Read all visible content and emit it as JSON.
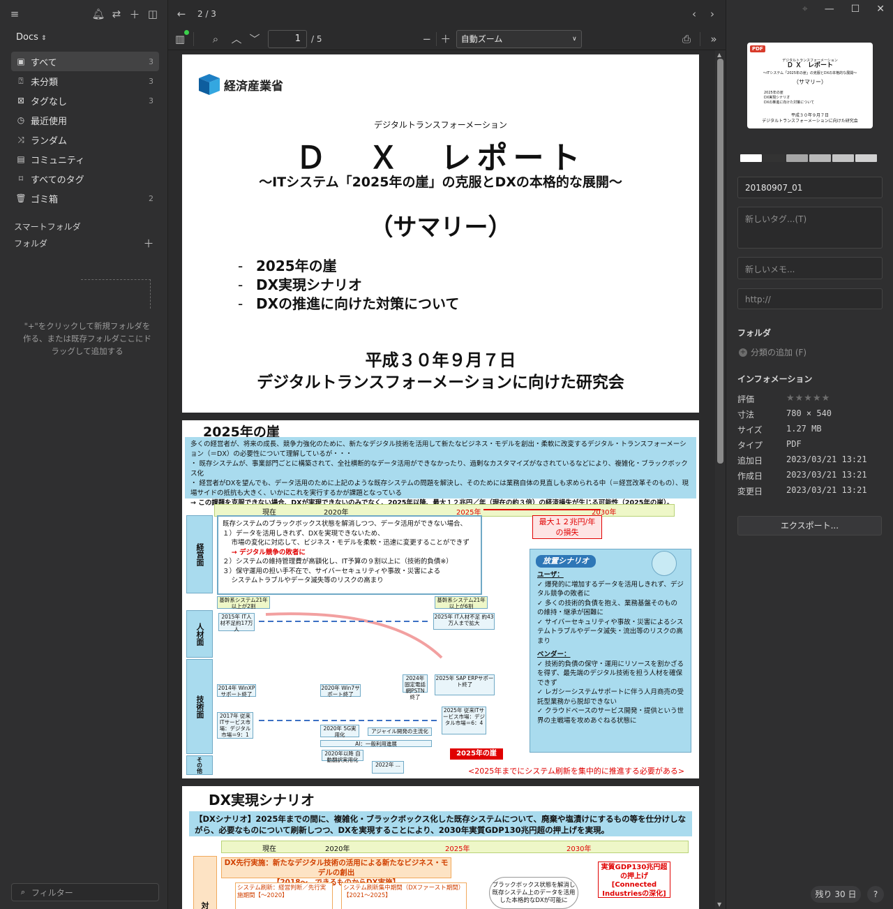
{
  "sidebar": {
    "library": "Docs",
    "items": [
      {
        "label": "すべて",
        "count": "3",
        "icon": "all-docs-icon"
      },
      {
        "label": "未分類",
        "count": "3",
        "icon": "unsorted-icon"
      },
      {
        "label": "タグなし",
        "count": "3",
        "icon": "untagged-icon"
      },
      {
        "label": "最近使用",
        "count": "",
        "icon": "recent-icon"
      },
      {
        "label": "ランダム",
        "count": "",
        "icon": "random-icon"
      },
      {
        "label": "コミュニティ",
        "count": "",
        "icon": "community-icon"
      },
      {
        "label": "すべてのタグ",
        "count": "",
        "icon": "tag-icon"
      },
      {
        "label": "ゴミ箱",
        "count": "2",
        "icon": "trash-icon"
      }
    ],
    "smart_folders": "スマートフォルダ",
    "folders": "フォルダ",
    "folder_hint": "\"+\"をクリックして新規フォルダを作る、または既存フォルダここにドラッグして追加する",
    "filter_placeholder": "フィルター"
  },
  "viewer": {
    "page_counter": "2 / 3",
    "pdf_page": "1",
    "pdf_total": "/ 5",
    "zoom": "自動ズーム"
  },
  "page1": {
    "org": "経済産業省",
    "kicker": "デジタルトランスフォーメーション",
    "title": "Ｄ　Ｘ　レポート",
    "subtitle": "～ITシステム「2025年の崖」の克服とDXの本格的な展開～",
    "summary": "（サマリー）",
    "bullets": [
      "2025年の崖",
      "DX実現シナリオ",
      "DXの推進に向けた対策について"
    ],
    "date": "平成３０年９月７日",
    "group": "デジタルトランスフォーメーションに向けた研究会"
  },
  "page2": {
    "title": "2025年の崖",
    "intro1": "多くの経営者が、将来の成長、競争力強化のために、新たなデジタル技術を活用して新たなビジネス・モデルを創出・柔軟に改変するデジタル・トランスフォーメーション（＝DX）の必要性について理解しているが・・・",
    "intro2": "・ 既存システムが、事業部門ごとに構築されて、全社横断的なデータ活用ができなかったり、過剰なカスタマイズがなされているなどにより、複雑化・ブラックボックス化",
    "intro3": "・ 経営者がDXを望んでも、データ活用のために上記のような既存システムの問題を解決し、そのためには業務自体の見直しも求められる中（＝経営改革そのもの）、現場サイドの抵抗も大きく、いかにこれを実行するかが課題となっている",
    "intro4": "→ この課題を克服できない場合、DXが実現できないのみでなく、2025年以降、最大１２兆円／年（現在の約３倍）の経済損失が生じる可能性（2025年の崖）。",
    "timeline": {
      "now": "現在",
      "y2020": "2020年",
      "y2025": "2025年",
      "y2030": "2030年"
    },
    "loss": "最大１２兆円/年\nの損失",
    "side_labels": [
      "経営面",
      "人材面",
      "技術面",
      "その他"
    ],
    "flow_lines": [
      "既存システムのブラックボックス状態を解消しつつ、データ活用ができない場合、",
      "１）データを活用しきれず、DXを実現できないため、",
      "　 市場の変化に対応して、ビジネス・モデルを柔軟・迅速に変更することができず",
      "　 → デジタル競争の敗者に",
      "２）システムの維持管理費が高額化し、IT予算の９割以上に（技術的負債※）",
      "３）保守運用の担い手不在で、サイバーセキュリティや事故・災害による",
      "　 システムトラブルやデータ滅失等のリスクの高まり"
    ],
    "scenario_tag": "放置シナリオ",
    "user_head": "ユーザ：",
    "user_items": [
      "✓ 爆発的に増加するデータを活用しきれず、デジタル競争の敗者に",
      "✓ 多くの技術的負債を抱え、業務基盤そのものの維持・継承が困難に",
      "✓ サイバーセキュリティや事故・災害によるシステムトラブルやデータ滅失・流出等のリスクの高まり"
    ],
    "vendor_head": "ベンダー：",
    "vendor_items": [
      "✓ 技術的負債の保守・運用にリソースを割かざるを得ず、最先端のデジタル技術を担う人材を確保できず",
      "✓ レガシーシステムサポートに伴う人月商売の受託型業務から脱却できない",
      "✓ クラウドベースのサービス開発・提供という世界の主戦場を攻めあぐねる状態に"
    ],
    "mini_labels": [
      "基幹系システム21年以上が2割",
      "基幹系システム21年以上が6割",
      "2015年 IT人材不足約17万人",
      "2025年 IT人材不足 約43万人まで拡大",
      "2014年 WinXPサポート終了",
      "2020年 Win7サポート終了",
      "2024年 固定電話網PSTN終了",
      "2025年 SAP ERPサポート終了",
      "2017年 従来ITサービス市場：デジタル市場＝9：1",
      "2025年 従来ITサービス市場：デジタル市場＝6：4",
      "2020年 5G実用化",
      "アジャイル開発の主流化",
      "AI：一般利用進展",
      "2020年以降 自動翻訳実用化",
      "2022年 ..."
    ],
    "cliff": "2025年の崖",
    "bottom_note": "<2025年までにシステム刷新を集中的に推進する必要がある>"
  },
  "page3": {
    "title": "DX実現シナリオ",
    "banner": "【DXシナリオ】2025年までの間に、複雑化・ブラックボックス化した既存システムについて、廃棄や塩漬けにするもの等を仕分けしながら、必要なものについて刷新しつつ、DXを実現することにより、2030年実質GDP130兆円超の押上げを実現。",
    "timeline": {
      "now": "現在",
      "y2020": "2020年",
      "y2025": "2025年",
      "y2030": "2030年"
    },
    "orange_box": "DX先行実施：新たなデジタル技術の活用による新たなビジネス・モデルの創出\n【2018～、できるものからDX実施】",
    "col_label": "対",
    "small1": "システム刷新：経営判断／先行実施期間【～2020】",
    "small2": "システム刷新集中期間（DXファースト期間）【2021～2025】",
    "cloud": "ブラックボックス状態を解消し既存システム上のデータを活用した本格的なDXが可能に",
    "gdp": "実質GDP130兆円超の押上げ\n[Connected Industriesの深化]"
  },
  "rpanel": {
    "thumb_lines": [
      "デジタルトランスフォーメーション",
      "Ｄ Ｘ　レポート",
      "～ITシステム「2025年の崖」の克服とDXの本格的な展開～",
      "（サマリー）",
      "2025年の崖",
      "DX実現シナリオ",
      "DXの推進に向けた対策について",
      "平成３０年９月７日",
      "デジタルトランスフォーメーションに向けた研究会"
    ],
    "swatches": [
      "#ffffff",
      "#333333",
      "#a6a6a6",
      "#b9b9b9",
      "#c5c5c5",
      "#d1d1d1"
    ],
    "name": "20180907_01",
    "tag_placeholder": "新しいタグ...(T)",
    "memo_placeholder": "新しいメモ...",
    "url_placeholder": "http://",
    "folder_label": "フォルダ",
    "add_category": "分類の追加 (F)",
    "info_label": "インフォメーション",
    "info": [
      {
        "k": "評価",
        "v": ""
      },
      {
        "k": "寸法",
        "v": "780 × 540"
      },
      {
        "k": "サイズ",
        "v": "1.27 MB"
      },
      {
        "k": "タイプ",
        "v": "PDF"
      },
      {
        "k": "追加日",
        "v": "2023/03/21 13:21"
      },
      {
        "k": "作成日",
        "v": "2023/03/21 13:21"
      },
      {
        "k": "変更日",
        "v": "2023/03/21 13:21"
      }
    ],
    "export": "エクスポート...",
    "trial": "残り 30 日",
    "help": "?"
  }
}
